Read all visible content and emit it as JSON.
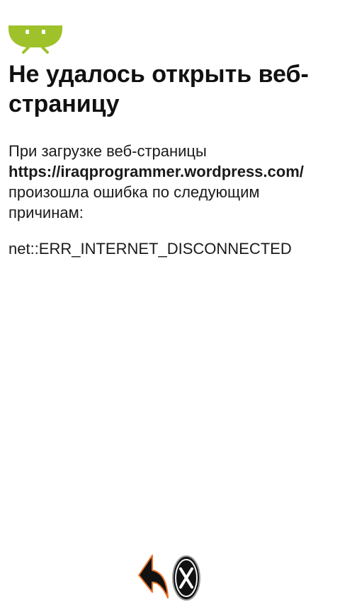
{
  "error_page": {
    "title": "Не удалось открыть веб-страницу",
    "message_before": "При загрузке веб-страницы",
    "url": "https://iraqprogrammer.wordpress.com/",
    "message_after": "произошла ошибка по следующим причинам:",
    "error_code": "net::ERR_INTERNET_DISCONNECTED"
  },
  "icons": {
    "header": "android-robot-icon",
    "back": "back-arrow-icon",
    "close": "close-x-icon"
  },
  "colors": {
    "android_green": "#9fc12a",
    "back_arrow_fill": "#111111",
    "back_arrow_outline": "#e8732a",
    "close_fill": "#111111"
  }
}
